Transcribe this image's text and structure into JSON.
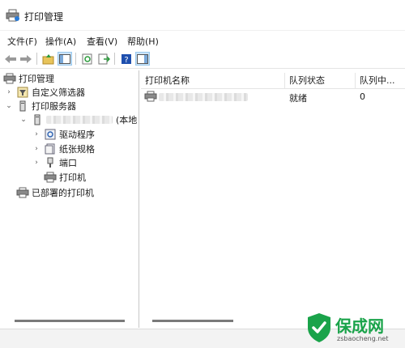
{
  "window": {
    "title": "打印管理"
  },
  "menu": [
    {
      "label": "文件(F)"
    },
    {
      "label": "操作(A)"
    },
    {
      "label": "查看(V)"
    },
    {
      "label": "帮助(H)"
    }
  ],
  "toolbar": {
    "icons": [
      "back-arrow-icon",
      "forward-arrow-icon",
      "up-folder-icon",
      "show-hide-tree-icon",
      "refresh-icon",
      "export-list-icon",
      "help-icon",
      "show-hide-action-pane-icon"
    ]
  },
  "tree": {
    "root": "打印管理",
    "custom_filters": "自定义筛选器",
    "print_servers": "打印服务器",
    "server_suffix": "(本地",
    "drivers": "驱动程序",
    "forms": "纸张规格",
    "ports": "端口",
    "printers": "打印机",
    "deployed": "已部署的打印机"
  },
  "table": {
    "columns": [
      "打印机名称",
      "队列状态",
      "队列中..."
    ],
    "rows": [
      {
        "status": "就绪",
        "jobs": "0"
      }
    ]
  },
  "watermark": {
    "brand": "保成网",
    "url": "zsbaocheng.net"
  },
  "colors": {
    "selection": "#cce4f7",
    "accent": "#1a6fc4",
    "watermark_green": "#1aa34a"
  }
}
